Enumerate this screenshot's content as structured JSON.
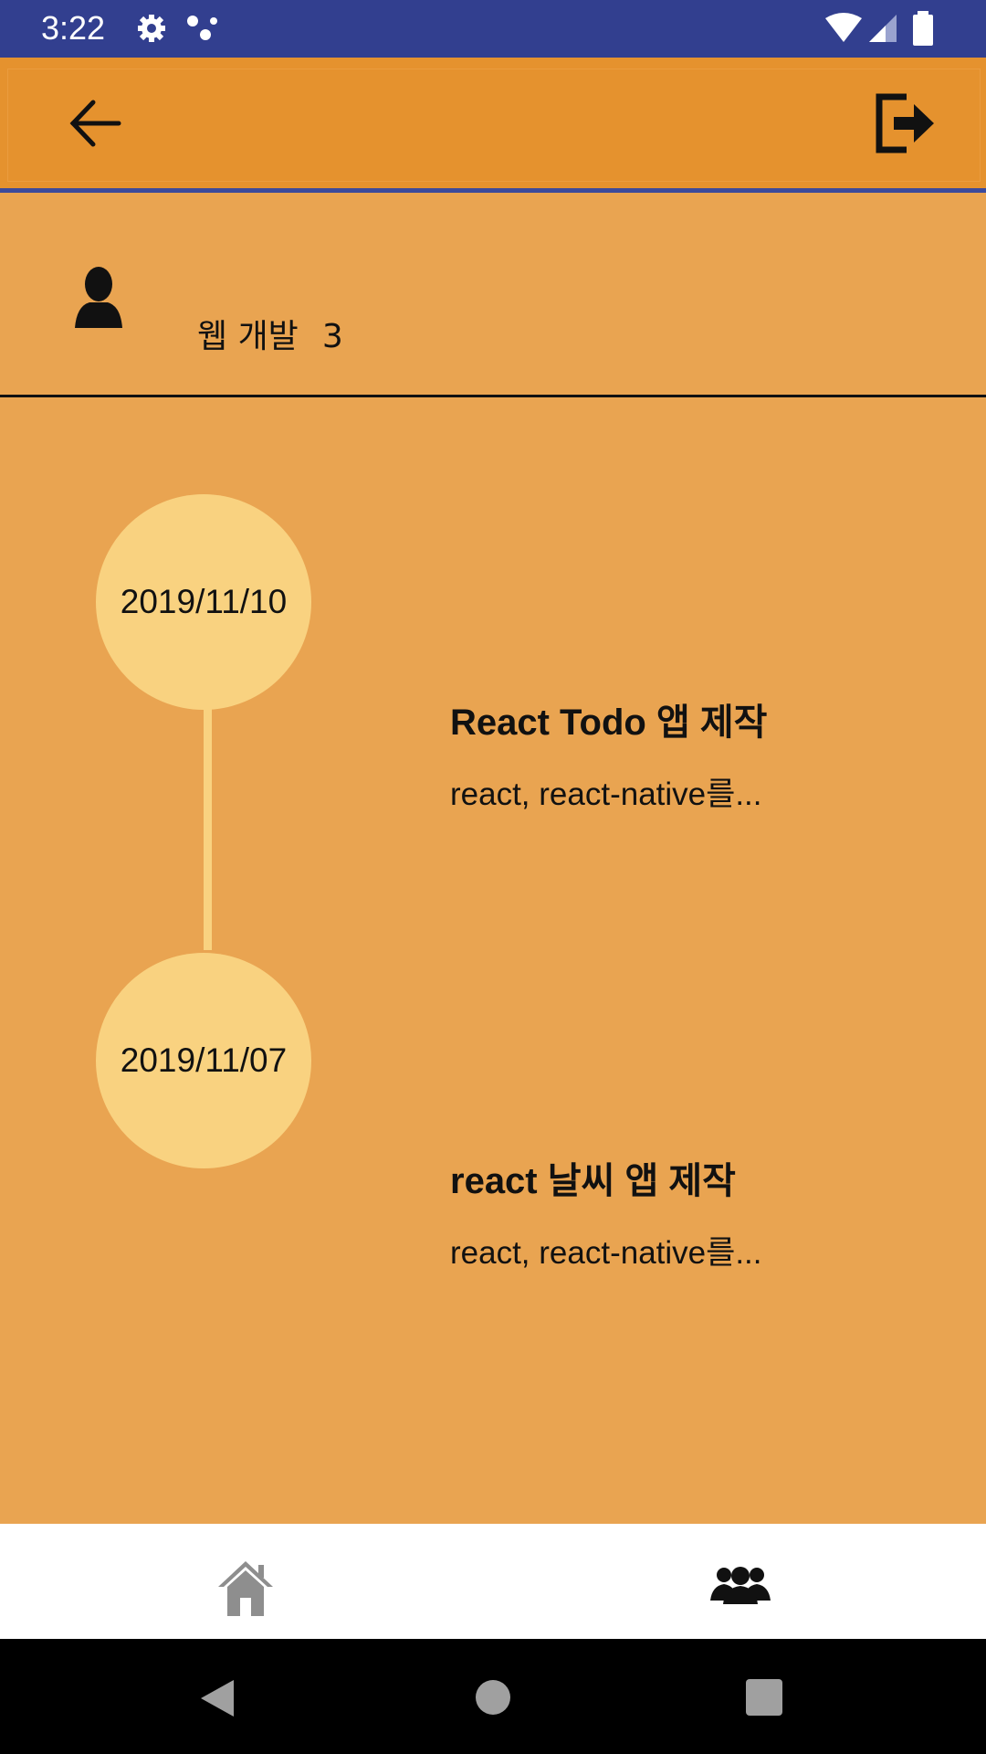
{
  "status_bar": {
    "time": "3:22",
    "left_icons": [
      "gear-icon",
      "dots-icon"
    ],
    "right_icons": [
      "wifi-icon",
      "signal-icon",
      "battery-icon"
    ],
    "background": "#323F8F"
  },
  "app_bar": {
    "back_icon": "arrow-left-icon",
    "logout_icon": "logout-icon",
    "background": "#E5922E"
  },
  "profile": {
    "icon": "person-icon",
    "name": "웹 개발",
    "count": "3"
  },
  "timeline": {
    "items": [
      {
        "date": "2019/11/10",
        "title": "React Todo 앱 제작",
        "description": "react, react-native를..."
      },
      {
        "date": "2019/11/07",
        "title": "react 날씨 앱 제작",
        "description": "react, react-native를..."
      }
    ],
    "circle_color": "#F9D280"
  },
  "bottom_nav": {
    "items": [
      {
        "icon": "home-icon",
        "active": false
      },
      {
        "icon": "people-icon",
        "active": true
      }
    ]
  },
  "system_nav": {
    "buttons": [
      "back-triangle-icon",
      "home-circle-icon",
      "recents-square-icon"
    ]
  },
  "colors": {
    "page_background": "#E9A451",
    "accent": "#3C4A9B"
  }
}
